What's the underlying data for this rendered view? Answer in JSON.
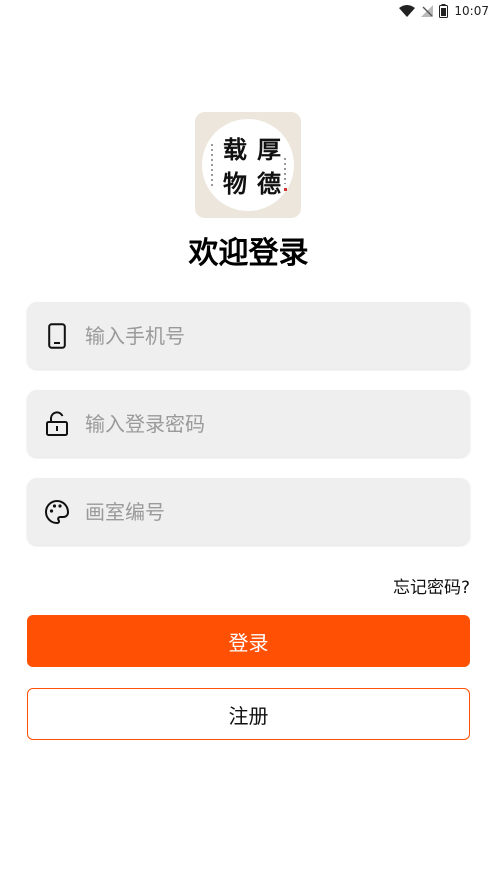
{
  "status_bar": {
    "time": "10:07",
    "icons": [
      "wifi-icon",
      "no-signal-icon",
      "battery-icon"
    ]
  },
  "logo": {
    "characters": [
      "厚",
      "德",
      "载",
      "物"
    ]
  },
  "title": "欢迎登录",
  "fields": {
    "phone": {
      "placeholder": "输入手机号",
      "value": "",
      "icon": "phone-icon"
    },
    "password": {
      "placeholder": "输入登录密码",
      "value": "",
      "icon": "unlock-icon"
    },
    "studio": {
      "placeholder": "画室编号",
      "value": "",
      "icon": "palette-icon"
    }
  },
  "forgot_password": "忘记密码?",
  "buttons": {
    "login": "登录",
    "register": "注册"
  },
  "colors": {
    "accent": "#ff5004",
    "field_bg": "#efefef",
    "placeholder": "#9a9a9a"
  }
}
